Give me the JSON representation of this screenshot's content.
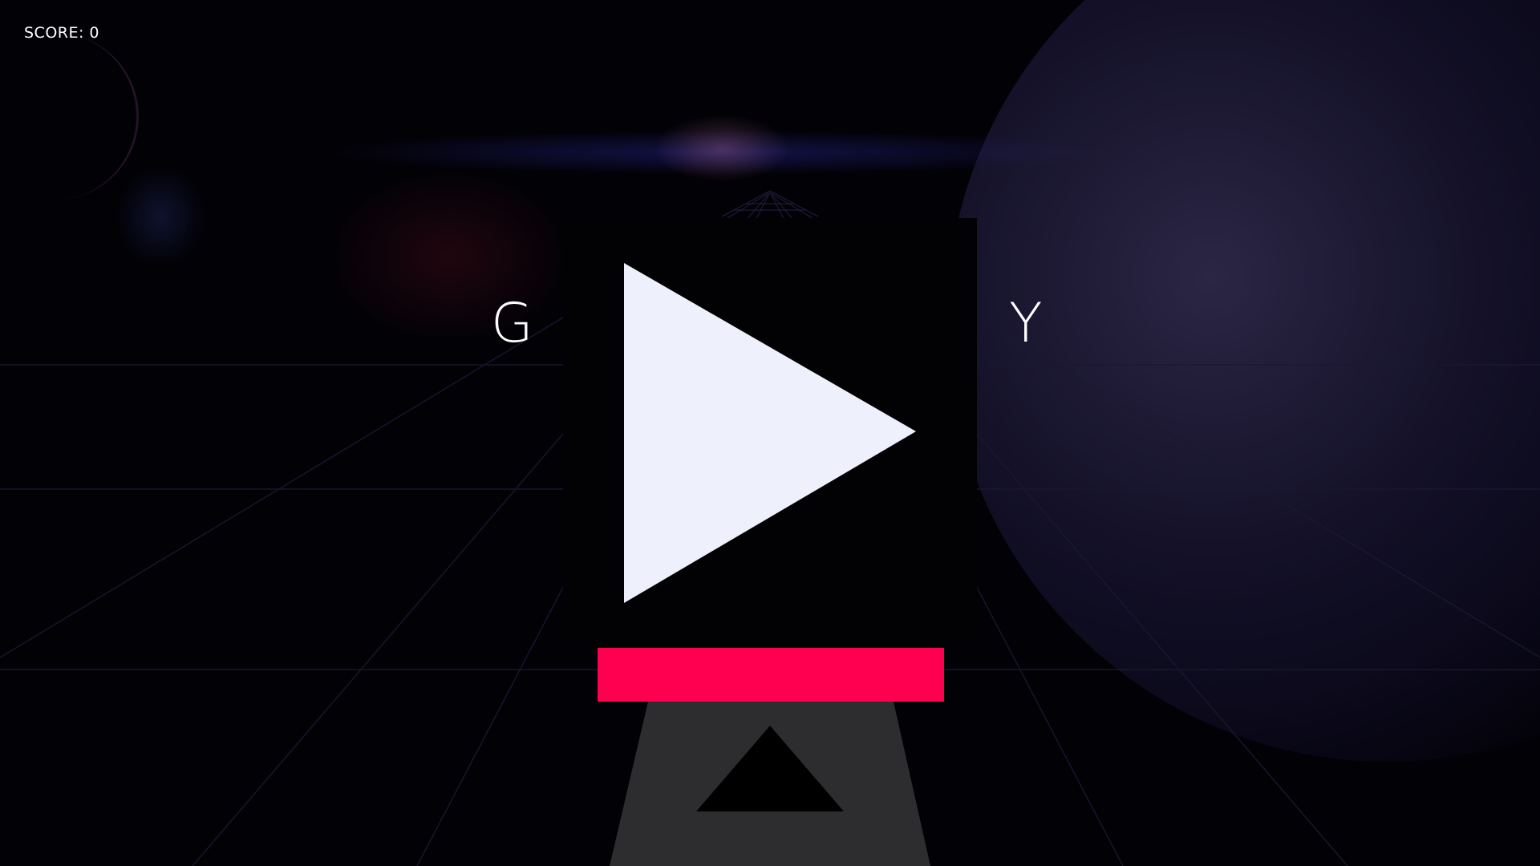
{
  "hud": {
    "score_label": "SCORE: 0"
  },
  "title": {
    "left_letter": "G",
    "right_letter": "Y"
  },
  "play_button": {
    "icon": "play-icon",
    "color": "#eef0fb",
    "panel_color": "#020204"
  },
  "play_bar": {
    "color": "#ff0050"
  },
  "ship": {
    "body_color": "#2d2d2f",
    "marker_icon": "up-triangle-icon",
    "marker_color": "#000000"
  },
  "colors": {
    "background": "#020106",
    "grid_line": "#1a1930",
    "text": "#ffffff"
  }
}
